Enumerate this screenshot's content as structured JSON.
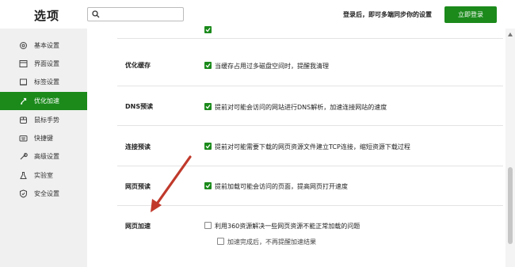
{
  "header": {
    "title": "选项",
    "search_placeholder": "",
    "login_tip": "登录后，即可多端同步你的设置",
    "login_button": "立即登录"
  },
  "sidebar": {
    "items": [
      {
        "label": "基本设置",
        "icon": "gear-icon"
      },
      {
        "label": "界面设置",
        "icon": "window-icon"
      },
      {
        "label": "标签设置",
        "icon": "tab-icon"
      },
      {
        "label": "优化加速",
        "icon": "rocket-icon",
        "active": true
      },
      {
        "label": "鼠标手势",
        "icon": "mouse-icon"
      },
      {
        "label": "快捷键",
        "icon": "keyboard-icon"
      },
      {
        "label": "高级设置",
        "icon": "wrench-icon"
      },
      {
        "label": "实验室",
        "icon": "flask-icon"
      },
      {
        "label": "安全设置",
        "icon": "shield-icon"
      }
    ]
  },
  "settings": {
    "optimize_cache": {
      "label": "优化缓存",
      "option": "当缓存占用过多磁盘空间时，提醒我清理",
      "checked": true
    },
    "dns_prefetch": {
      "label": "DNS预读",
      "option": "提前对可能会访问的网站进行DNS解析，加速连接网站的速度",
      "checked": true
    },
    "connection_prefetch": {
      "label": "连接预读",
      "option": "提前对可能需要下载的网页资源文件建立TCP连接，缩短资源下载过程",
      "checked": true
    },
    "page_prefetch": {
      "label": "网页预读",
      "option": "提前加载可能会访问的页面，提高网页打开速度",
      "checked": true
    },
    "page_acceleration": {
      "label": "网页加速",
      "option": "利用360资源解决一些网页资源不能正常加载的问题",
      "checked": false,
      "sub_option": "加速完成后，不再提醒加速结果",
      "sub_checked": false
    }
  },
  "colors": {
    "accent": "#1b8a1b",
    "annotation_arrow": "#c0392b"
  }
}
